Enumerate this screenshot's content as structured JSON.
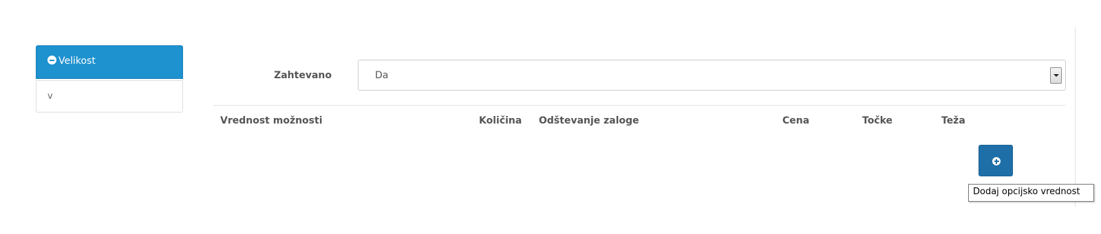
{
  "options": {
    "active_tab": {
      "label": "Velikost",
      "icon": "minus-circle-icon"
    },
    "items": [
      {
        "label": "v"
      }
    ]
  },
  "required": {
    "label": "Zahtevano",
    "selected_value": "Da"
  },
  "table": {
    "headers": [
      "Vrednost možnosti",
      "Količina",
      "Odštevanje zaloge",
      "Cena",
      "Točke",
      "Teža"
    ]
  },
  "add_button": {
    "icon": "plus-circle-icon",
    "tooltip": "Dodaj opcijsko vrednost"
  },
  "colors": {
    "accent": "#1e91cf",
    "button": "#1e6fa8"
  }
}
